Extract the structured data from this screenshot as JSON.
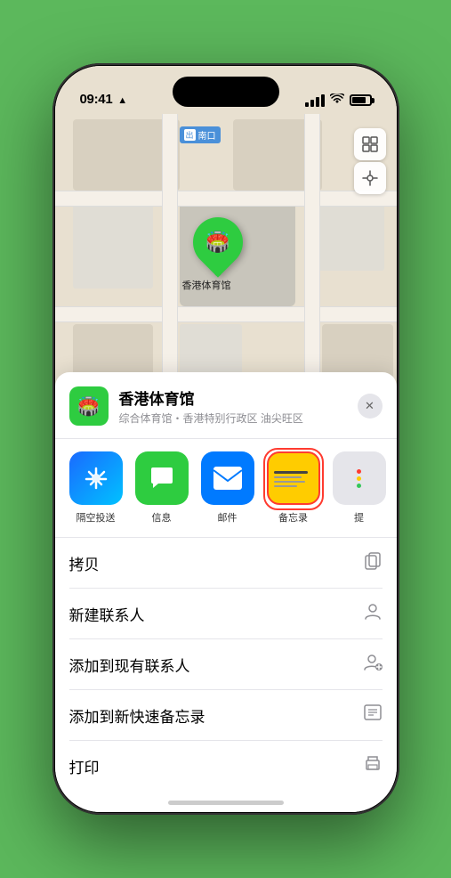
{
  "status_bar": {
    "time": "09:41",
    "location_indicator": "▲"
  },
  "map": {
    "label": "南口",
    "label_prefix": "出"
  },
  "location": {
    "name": "香港体育馆",
    "subtitle": "综合体育馆・香港特别行政区 油尖旺区",
    "icon": "🏟️"
  },
  "share_items": [
    {
      "id": "airdrop",
      "label": "隔空投送"
    },
    {
      "id": "message",
      "label": "信息"
    },
    {
      "id": "mail",
      "label": "邮件"
    },
    {
      "id": "notes",
      "label": "备忘录"
    },
    {
      "id": "more",
      "label": "提"
    }
  ],
  "actions": [
    {
      "id": "copy",
      "label": "拷贝"
    },
    {
      "id": "new-contact",
      "label": "新建联系人"
    },
    {
      "id": "add-contact",
      "label": "添加到现有联系人"
    },
    {
      "id": "quick-note",
      "label": "添加到新快速备忘录"
    },
    {
      "id": "print",
      "label": "打印"
    }
  ],
  "close_label": "✕"
}
